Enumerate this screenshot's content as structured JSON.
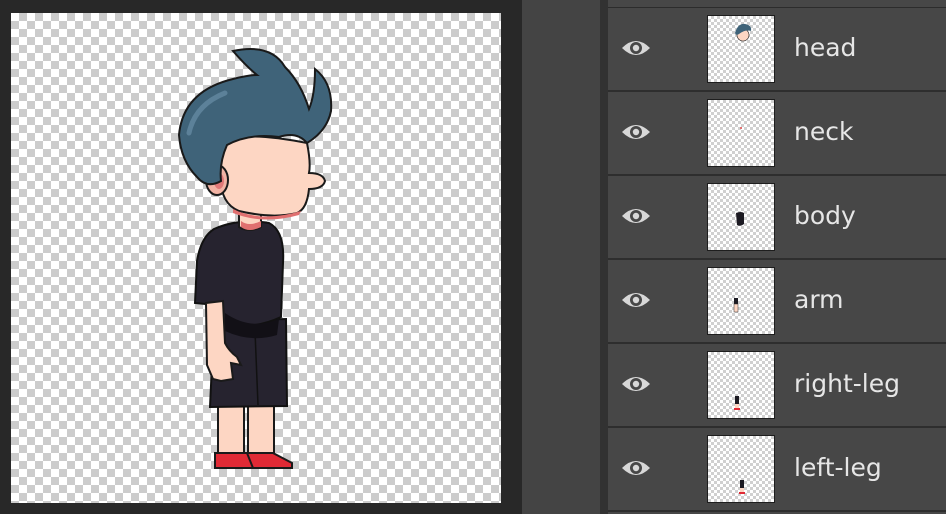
{
  "canvas": {
    "description": "character artwork on transparent background"
  },
  "layers_panel": {
    "layers": [
      {
        "name": "head",
        "visible": true,
        "thumb_icon": "head-thumbnail"
      },
      {
        "name": "neck",
        "visible": true,
        "thumb_icon": "neck-thumbnail"
      },
      {
        "name": "body",
        "visible": true,
        "thumb_icon": "body-thumbnail"
      },
      {
        "name": "arm",
        "visible": true,
        "thumb_icon": "arm-thumbnail"
      },
      {
        "name": "right-leg",
        "visible": true,
        "thumb_icon": "right-leg-thumbnail"
      },
      {
        "name": "left-leg",
        "visible": true,
        "thumb_icon": "left-leg-thumbnail"
      }
    ]
  },
  "colors": {
    "panel_bg": "#474747",
    "row_border": "#2e2e2e",
    "text": "#e6e6e6",
    "hair": "#3f6379",
    "skin": "#fdd6c3",
    "shirt": "#26232f",
    "shoe": "#e02a35"
  }
}
